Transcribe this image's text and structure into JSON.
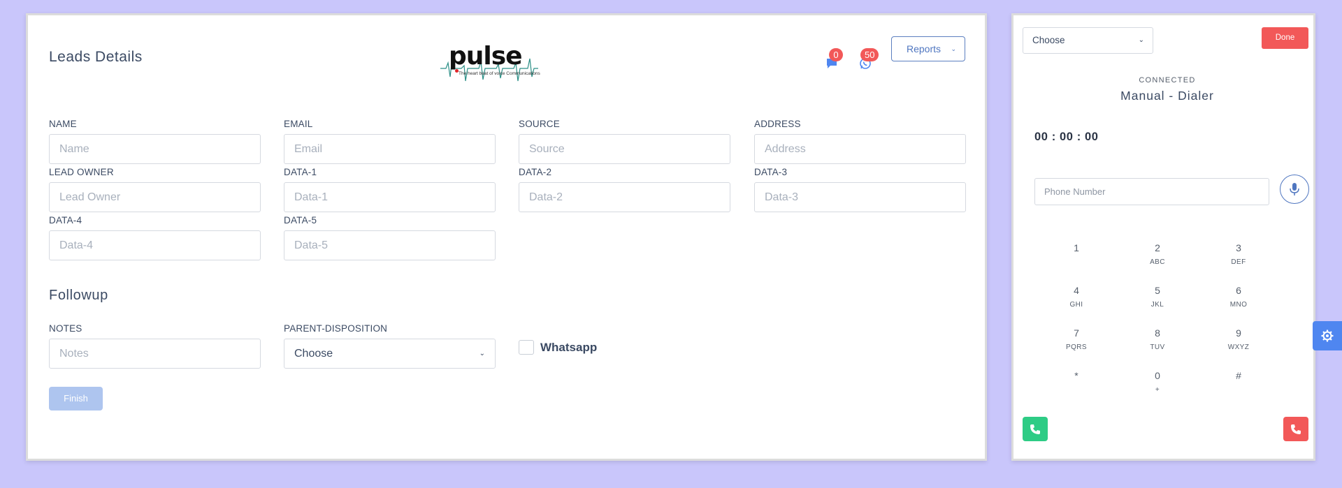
{
  "header": {
    "page_title": "Leads Details",
    "logo": {
      "brand": "pulse",
      "tagline": "The heart beat of voice Communications"
    },
    "chat_count": "0",
    "whatsapp_count": "50",
    "reports_label": "Reports"
  },
  "lead_fields": [
    {
      "label": "NAME",
      "placeholder": "Name"
    },
    {
      "label": "EMAIL",
      "placeholder": "Email"
    },
    {
      "label": "SOURCE",
      "placeholder": "Source"
    },
    {
      "label": "ADDRESS",
      "placeholder": "Address"
    },
    {
      "label": "LEAD OWNER",
      "placeholder": "Lead Owner"
    },
    {
      "label": "DATA-1",
      "placeholder": "Data-1"
    },
    {
      "label": "DATA-2",
      "placeholder": "Data-2"
    },
    {
      "label": "DATA-3",
      "placeholder": "Data-3"
    },
    {
      "label": "DATA-4",
      "placeholder": "Data-4"
    },
    {
      "label": "DATA-5",
      "placeholder": "Data-5"
    }
  ],
  "followup": {
    "title": "Followup",
    "notes_label": "NOTES",
    "notes_placeholder": "Notes",
    "parent_disposition_label": "PARENT-DISPOSITION",
    "parent_disposition_value": "Choose",
    "whatsapp_label": "Whatsapp",
    "finish_label": "Finish"
  },
  "dialer": {
    "select_value": "Choose",
    "done_label": "Done",
    "status": "CONNECTED",
    "mode": "Manual - Dialer",
    "timer": "00 : 00 : 00",
    "phone_placeholder": "Phone Number",
    "keys": [
      {
        "num": "1",
        "letters": ""
      },
      {
        "num": "2",
        "letters": "ABC"
      },
      {
        "num": "3",
        "letters": "DEF"
      },
      {
        "num": "4",
        "letters": "GHI"
      },
      {
        "num": "5",
        "letters": "JKL"
      },
      {
        "num": "6",
        "letters": "MNO"
      },
      {
        "num": "7",
        "letters": "PQRS"
      },
      {
        "num": "8",
        "letters": "TUV"
      },
      {
        "num": "9",
        "letters": "WXYZ"
      },
      {
        "num": "*",
        "letters": ""
      },
      {
        "num": "0",
        "letters": "+"
      },
      {
        "num": "#",
        "letters": ""
      }
    ]
  },
  "colors": {
    "background": "#c9c6fb",
    "accent": "#4f76c0",
    "danger": "#f25858",
    "success": "#2ecc85",
    "finish_disabled": "#aec5ef"
  },
  "icons": [
    "chat-icon",
    "whatsapp-icon",
    "chevron-down-icon",
    "microphone-icon",
    "phone-call-icon",
    "phone-hangup-icon",
    "settings-gear-icon"
  ]
}
